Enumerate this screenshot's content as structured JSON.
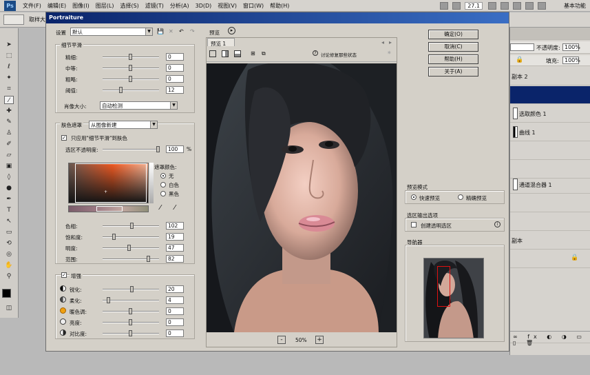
{
  "menubar": {
    "logo": "Ps",
    "items": [
      "文件(F)",
      "编辑(E)",
      "图像(I)",
      "图层(L)",
      "选择(S)",
      "滤镜(T)",
      "分析(A)",
      "3D(D)",
      "视图(V)",
      "窗口(W)",
      "帮助(H)"
    ],
    "zoom": "27.1",
    "workspace": "基本功能"
  },
  "optionsbar": {
    "sample_label": "取样大"
  },
  "rightpanel": {
    "opacity_label": "不透明度:",
    "opacity_value": "100%",
    "fill_label": "填充:",
    "fill_value": "100%",
    "layers": [
      "副本 2",
      "选取颜色 1",
      "曲线 1",
      "通道混合器 1",
      "副本"
    ]
  },
  "dialog": {
    "title": "Portraiture",
    "preset_label": "设置",
    "preset_value": "默认",
    "preview_label": "预览",
    "preview_tab": "预览 1",
    "preview_hint": "讨论修复那些状态",
    "detail": {
      "title": "细节平滑",
      "rows": [
        {
          "label": "精细:",
          "value": "0"
        },
        {
          "label": "中等:",
          "value": "0"
        },
        {
          "label": "粗略:",
          "value": "0"
        },
        {
          "label": "阈值:",
          "value": "12"
        }
      ],
      "portrait_size_label": "肖像大小:",
      "portrait_size_value": "自动检测"
    },
    "skin": {
      "title": "肤色遮罩",
      "source_value": "从图像新建",
      "apply_label": "只应用\"细节平滑\"到肤色",
      "opacity_label": "选区不透明度:",
      "opacity_value": "100",
      "opacity_unit": "%",
      "mask_label": "遮罩颜色:",
      "mask_options": [
        "无",
        "白色",
        "黑色"
      ],
      "rows": [
        {
          "label": "色相:",
          "value": "102"
        },
        {
          "label": "饱和度:",
          "value": "19"
        },
        {
          "label": "明度:",
          "value": "47"
        },
        {
          "label": "范围:",
          "value": "82"
        }
      ]
    },
    "enhance": {
      "title": "增强",
      "rows": [
        {
          "label": "锐化:",
          "value": "20"
        },
        {
          "label": "柔化:",
          "value": "4"
        },
        {
          "label": "暖色调:",
          "value": "0"
        },
        {
          "label": "亮度:",
          "value": "0"
        },
        {
          "label": "对比度:",
          "value": "0"
        }
      ]
    },
    "buttons": {
      "ok": "确定(O)",
      "cancel": "取消(C)",
      "help": "帮助(H)",
      "about": "关于(A)"
    },
    "preview_mode": {
      "title": "预览模式",
      "fast": "快速预览",
      "accurate": "精确预览"
    },
    "selection": {
      "title": "选区输出选项",
      "create": "创建透明选区"
    },
    "navigator": {
      "title": "导航器"
    },
    "zoom": {
      "value": "50%",
      "minus": "-",
      "plus": "+"
    }
  },
  "colors": {
    "title_start": "#0a246a",
    "title_end": "#3a6ec4",
    "dialog_bg": "#d4d0c8",
    "nav_rect": "#e01010"
  }
}
